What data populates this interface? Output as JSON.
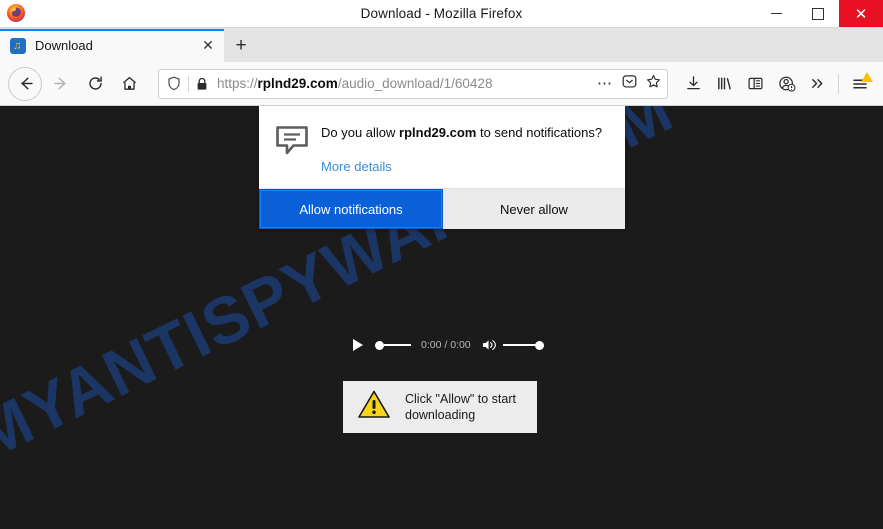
{
  "window": {
    "title": "Download - Mozilla Firefox",
    "logo_icon": "firefox-logo",
    "controls": {
      "minimize_label": "—",
      "maximize_label": "□",
      "close_label": "✕"
    }
  },
  "tabstrip": {
    "tabs": [
      {
        "title": "Download",
        "favicon_icon": "audio-note-favicon",
        "close_label": "✕"
      }
    ],
    "new_tab_label": "+"
  },
  "toolbar": {
    "back_icon": "back-arrow-icon",
    "forward_icon": "forward-arrow-icon",
    "reload_icon": "reload-icon",
    "home_icon": "home-icon",
    "urlbar": {
      "shield_icon": "shield-icon",
      "lock_icon": "padlock-icon",
      "scheme": "https://",
      "host": "rplnd29.com",
      "path": "/audio_download/1/60428",
      "page_actions_icon": "ellipsis-icon",
      "pocket_icon": "pocket-icon",
      "bookmark_icon": "star-icon"
    },
    "right_icons": [
      {
        "name": "downloads-icon",
        "label": "Downloads"
      },
      {
        "name": "library-icon",
        "label": "Library"
      },
      {
        "name": "sidebar-icon",
        "label": "Sidebars"
      },
      {
        "name": "account-warning-icon",
        "label": "Account"
      },
      {
        "name": "overflow-chevrons-icon",
        "label": "»"
      },
      {
        "name": "hamburger-menu-icon",
        "label": "Open menu"
      }
    ]
  },
  "page": {
    "background_color": "#1b1b1b",
    "watermark_text": "MYANTISPYWARE.COM",
    "watermark_color": "#1b3a72"
  },
  "doorhanger": {
    "icon": "notification-bubble-icon",
    "question_prefix": "Do you allow ",
    "question_host": "rplnd29.com",
    "question_suffix": " to send notifications?",
    "more_details_label": "More details",
    "allow_label": "Allow notifications",
    "never_label": "Never allow",
    "allow_color": "#0a60d8"
  },
  "audio_player": {
    "play_icon": "play-icon",
    "current_time": "0:00",
    "separator": "/",
    "duration": "0:00",
    "volume_icon": "volume-icon"
  },
  "hint_box": {
    "warning_icon": "warning-triangle-icon",
    "line1": "Click \"Allow\" to start",
    "line2": "downloading",
    "background_color": "#ececec"
  }
}
